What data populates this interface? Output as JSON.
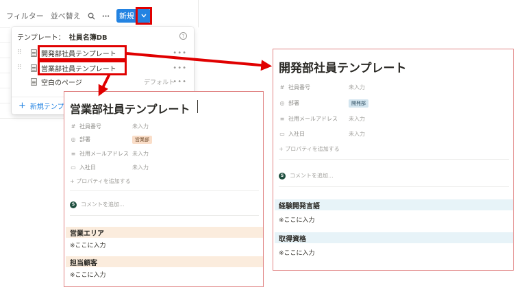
{
  "toolbar": {
    "filter": "フィルター",
    "sort": "並べ替え",
    "new_label": "新規"
  },
  "popup": {
    "heading": "テンプレート：",
    "db_name": "社員名簿DB",
    "items": [
      {
        "label": "開発部社員テンプレート"
      },
      {
        "label": "営業部社員テンプレート"
      },
      {
        "label": "空白のページ",
        "badge": "デフォルト"
      }
    ],
    "new_template": "新規テンプレ"
  },
  "sales_panel": {
    "title": "営業部社員テンプレート",
    "properties": [
      {
        "icon": "#",
        "name": "社員番号",
        "value": "未入力"
      },
      {
        "icon": "◎",
        "name": "部署",
        "value": "営業部"
      },
      {
        "icon": "≡",
        "name": "社用メールアドレス",
        "value": "未入力"
      },
      {
        "icon": "▭",
        "name": "入社日",
        "value": "未入力"
      }
    ],
    "add_property": "+ プロパティを追加する",
    "avatar": "S",
    "comment_placeholder": "コメントを追加...",
    "sections": [
      {
        "heading": "営業エリア",
        "text": "※ここに入力"
      },
      {
        "heading": "担当顧客",
        "text": "※ここに入力"
      }
    ],
    "section_color": "#fbecdd",
    "tag_color": "#fadec9"
  },
  "dev_panel": {
    "title": "開発部社員テンプレート",
    "properties": [
      {
        "icon": "#",
        "name": "社員番号",
        "value": "未入力"
      },
      {
        "icon": "◎",
        "name": "部署",
        "value": "開発部"
      },
      {
        "icon": "≡",
        "name": "社用メールアドレス",
        "value": "未入力"
      },
      {
        "icon": "▭",
        "name": "入社日",
        "value": "未入力"
      }
    ],
    "add_property": "+ プロパティを追加する",
    "avatar": "S",
    "comment_placeholder": "コメントを追加...",
    "sections": [
      {
        "heading": "経験開発言語",
        "text": "※ここに入力"
      },
      {
        "heading": "取得資格",
        "text": "※ここに入力"
      }
    ],
    "section_color": "#e7f3f8",
    "tag_color": "#d3e5ef"
  },
  "colors": {
    "highlight": "#e00000",
    "accent": "#2383e2"
  }
}
